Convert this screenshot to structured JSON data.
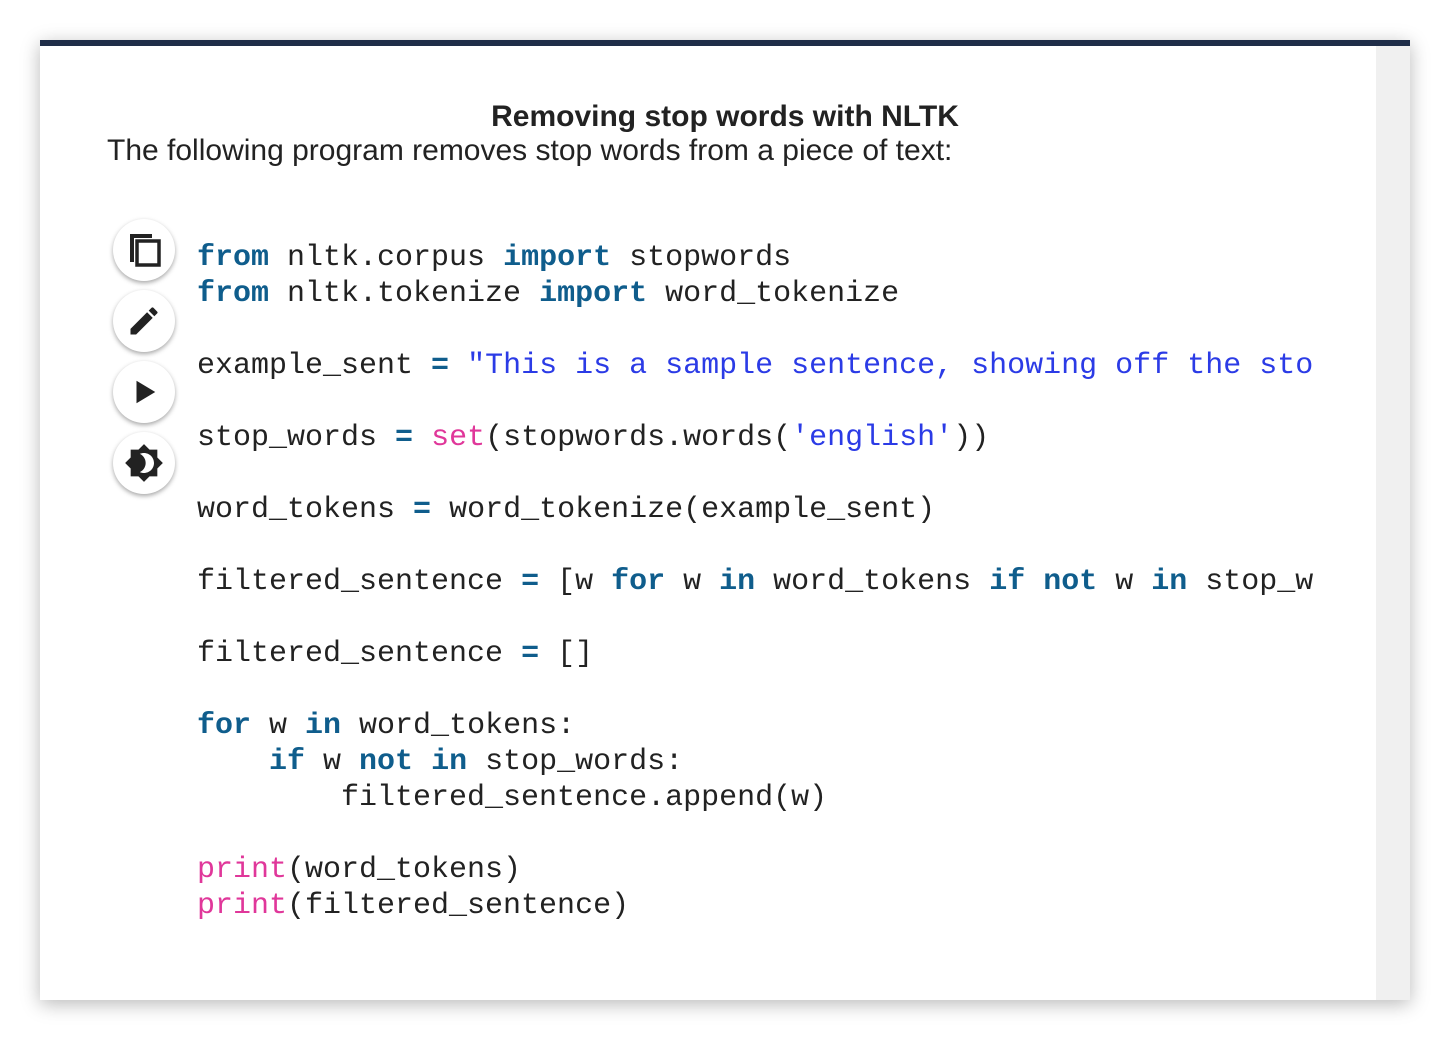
{
  "page": {
    "title": "Removing stop words with NLTK",
    "intro": "The following program removes stop words from a piece of text:"
  },
  "toolbar": {
    "buttons": [
      {
        "name": "copy",
        "icon": "copy-icon"
      },
      {
        "name": "edit",
        "icon": "pencil-icon"
      },
      {
        "name": "run",
        "icon": "play-icon"
      },
      {
        "name": "theme",
        "icon": "brightness-icon"
      }
    ]
  },
  "code": {
    "language": "python",
    "line1": {
      "kw1": "from",
      "t1": " nltk.corpus ",
      "kw2": "import",
      "t2": " stopwords"
    },
    "line2": {
      "kw1": "from",
      "t1": " nltk.tokenize ",
      "kw2": "import",
      "t2": " word_tokenize"
    },
    "line4": {
      "t1": "example_sent ",
      "op": "=",
      "t2": " ",
      "str": "\"This is a sample sentence, showing off the stop"
    },
    "line6": {
      "t1": "stop_words ",
      "op": "=",
      "t2": " ",
      "bi": "set",
      "t3": "(stopwords.words(",
      "str": "'english'",
      "t4": "))"
    },
    "line8": {
      "t1": "word_tokens ",
      "op": "=",
      "t2": " word_tokenize(example_sent)"
    },
    "line10": {
      "t1": "filtered_sentence ",
      "op": "=",
      "t2": " [w ",
      "kw1": "for",
      "t3": " w ",
      "kw2": "in",
      "t4": " word_tokens ",
      "kw3": "if",
      "t5": " ",
      "kw4": "not",
      "t6": " w ",
      "kw5": "in",
      "t7": " stop_words]"
    },
    "line12": {
      "t1": "filtered_sentence ",
      "op": "=",
      "t2": " []"
    },
    "line14": {
      "kw1": "for",
      "t1": " w ",
      "kw2": "in",
      "t2": " word_tokens:"
    },
    "line15": {
      "t0": "    ",
      "kw1": "if",
      "t1": " w ",
      "kw2": "not",
      "t2": " ",
      "kw3": "in",
      "t3": " stop_words:"
    },
    "line16": {
      "t1": "        filtered_sentence.append(w)"
    },
    "line18": {
      "bi": "print",
      "t1": "(word_tokens)"
    },
    "line19": {
      "bi": "print",
      "t1": "(filtered_sentence)"
    }
  },
  "colors": {
    "topbar": "#1f2d48",
    "keyword": "#0f5d8c",
    "string": "#2b3be6",
    "builtin": "#e0379a",
    "text": "#222222"
  }
}
